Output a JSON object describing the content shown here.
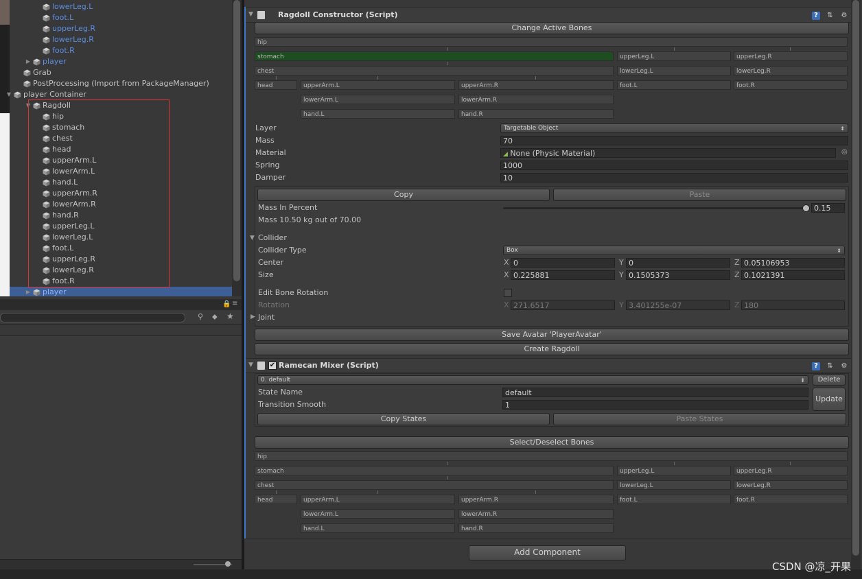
{
  "hierarchy": {
    "items": [
      {
        "label": "lowerLeg.L",
        "color": "blue"
      },
      {
        "label": "foot.L",
        "color": "blue"
      },
      {
        "label": "upperLeg.R",
        "color": "blue"
      },
      {
        "label": "lowerLeg.R",
        "color": "blue"
      },
      {
        "label": "foot.R",
        "color": "blue"
      },
      {
        "label": "player",
        "color": "blue"
      },
      {
        "label": "Grab",
        "color": "normal"
      },
      {
        "label": "PostProcessing (Import from PackageManager)",
        "color": "normal"
      },
      {
        "label": "player Container",
        "color": "normal"
      },
      {
        "label": "Ragdoll",
        "color": "normal"
      },
      {
        "label": "hip",
        "color": "normal"
      },
      {
        "label": "stomach",
        "color": "normal"
      },
      {
        "label": "chest",
        "color": "normal"
      },
      {
        "label": "head",
        "color": "normal"
      },
      {
        "label": "upperArm.L",
        "color": "normal"
      },
      {
        "label": "lowerArm.L",
        "color": "normal"
      },
      {
        "label": "hand.L",
        "color": "normal"
      },
      {
        "label": "upperArm.R",
        "color": "normal"
      },
      {
        "label": "lowerArm.R",
        "color": "normal"
      },
      {
        "label": "hand.R",
        "color": "normal"
      },
      {
        "label": "upperLeg.L",
        "color": "normal"
      },
      {
        "label": "lowerLeg.L",
        "color": "normal"
      },
      {
        "label": "foot.L",
        "color": "normal"
      },
      {
        "label": "upperLeg.R",
        "color": "normal"
      },
      {
        "label": "lowerLeg.R",
        "color": "normal"
      },
      {
        "label": "foot.R",
        "color": "normal"
      },
      {
        "label": "player",
        "color": "selected"
      }
    ]
  },
  "ragdoll_constructor": {
    "title": "Ragdoll Constructor (Script)",
    "change_active_bones": "Change Active Bones",
    "bones": {
      "hip": "hip",
      "stomach": "stomach",
      "chest": "chest",
      "head": "head",
      "upperArmL": "upperArm.L",
      "upperArmR": "upperArm.R",
      "lowerArmL": "lowerArm.L",
      "lowerArmR": "lowerArm.R",
      "handL": "hand.L",
      "handR": "hand.R",
      "upperLegL": "upperLeg.L",
      "upperLegR": "upperLeg.R",
      "lowerLegL": "lowerLeg.L",
      "lowerLegR": "lowerLeg.R",
      "footL": "foot.L",
      "footR": "foot.R"
    },
    "layer_label": "Layer",
    "layer_value": "Targetable Object",
    "mass_label": "Mass",
    "mass_value": "70",
    "material_label": "Material",
    "material_value": "None (Physic Material)",
    "spring_label": "Spring",
    "spring_value": "1000",
    "damper_label": "Damper",
    "damper_value": "10",
    "copy": "Copy",
    "paste": "Paste",
    "mass_percent_label": "Mass In Percent",
    "mass_percent_value": "0.15",
    "mass_percent_fraction": 0.15,
    "mass_info": "Mass 10.50 kg out of 70.00",
    "collider_label": "Collider",
    "collider_type_label": "Collider Type",
    "collider_type_value": "Box",
    "center_label": "Center",
    "center": {
      "x": "0",
      "y": "0",
      "z": "0.05106953"
    },
    "size_label": "Size",
    "size": {
      "x": "0.225881",
      "y": "0.1505373",
      "z": "0.1021391"
    },
    "axis": {
      "x": "X",
      "y": "Y",
      "z": "Z"
    },
    "edit_bone_rotation_label": "Edit Bone Rotation",
    "rotation_label": "Rotation",
    "rotation": {
      "x": "271.6517",
      "y": "3.401255e-07",
      "z": "180"
    },
    "joint_label": "Joint",
    "save_avatar": "Save Avatar 'PlayerAvatar'",
    "create_ragdoll": "Create Ragdoll"
  },
  "ramecan_mixer": {
    "title": "Ramecan Mixer (Script)",
    "state_select": "0. default",
    "delete": "Delete",
    "state_name_label": "State Name",
    "state_name_value": "default",
    "transition_label": "Transition Smooth",
    "transition_value": "1",
    "update": "Update",
    "copy_states": "Copy States",
    "paste_states": "Paste States",
    "select_bones": "Select/Deselect Bones"
  },
  "add_component": "Add Component",
  "watermark": "CSDN @凉_开果",
  "colors": {
    "selection": "#3e5f96",
    "link_blue": "#5b8ee6",
    "active_bone": "#1f4d22",
    "ragdoll_outline": "#dd3333"
  }
}
